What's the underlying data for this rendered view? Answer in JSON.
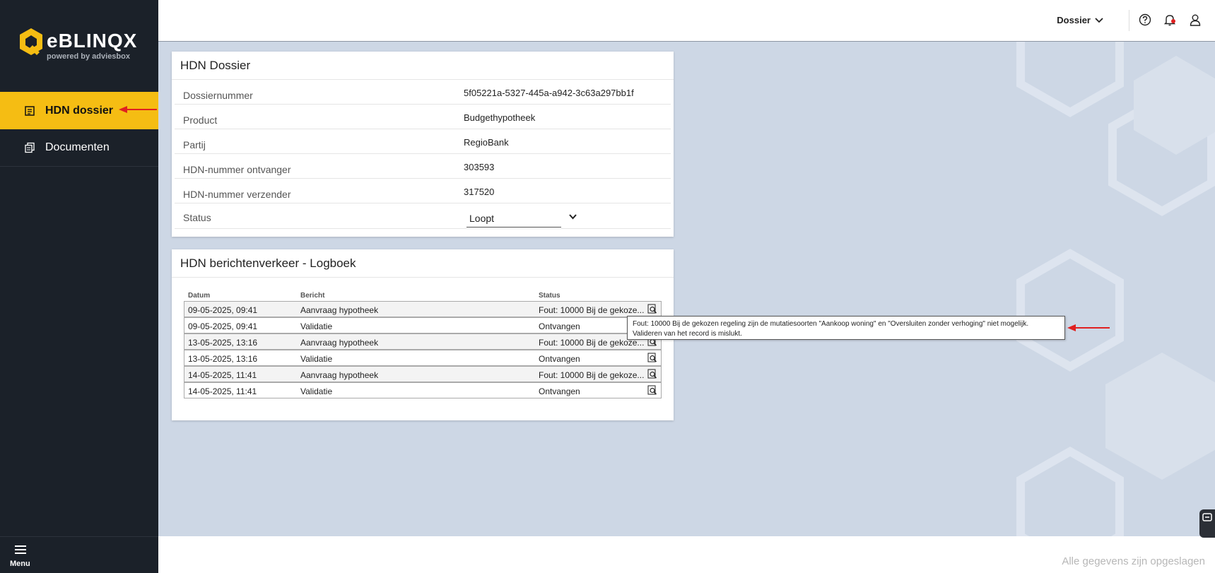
{
  "brand": {
    "name": "BLINQX",
    "e": "e",
    "tagline": "powered by adviesbox",
    "hex_color": "#f5bd13"
  },
  "sidebar": {
    "items": [
      {
        "label": "HDN dossier",
        "icon": "document-list-icon",
        "active": true
      },
      {
        "label": "Documenten",
        "icon": "documents-copy-icon",
        "active": false
      }
    ],
    "menu_label": "Menu"
  },
  "topbar": {
    "dossier_label": "Dossier",
    "icons": [
      "help-icon",
      "notification-bell-icon",
      "user-icon"
    ]
  },
  "hdn_dossier": {
    "title": "HDN Dossier",
    "fields": [
      {
        "label": "Dossiernummer",
        "value": "5f05221a-5327-445a-a942-3c63a297bb1f"
      },
      {
        "label": "Product",
        "value": "Budgethypotheek"
      },
      {
        "label": "Partij",
        "value": "RegioBank"
      },
      {
        "label": "HDN-nummer ontvanger",
        "value": "303593"
      },
      {
        "label": "HDN-nummer verzender",
        "value": "317520"
      }
    ],
    "status_label": "Status",
    "status_value": "Loopt"
  },
  "log": {
    "title": "HDN berichtenverkeer - Logboek",
    "headers": {
      "datum": "Datum",
      "bericht": "Bericht",
      "status": "Status"
    },
    "rows": [
      {
        "datum": "09-05-2025, 09:41",
        "bericht": "Aanvraag hypotheek",
        "status": "Fout: 10000 Bij de gekoze..."
      },
      {
        "datum": "09-05-2025, 09:41",
        "bericht": "Validatie",
        "status": "Ontvangen"
      },
      {
        "datum": "13-05-2025, 13:16",
        "bericht": "Aanvraag hypotheek",
        "status": "Fout: 10000 Bij de gekoze..."
      },
      {
        "datum": "13-05-2025, 13:16",
        "bericht": "Validatie",
        "status": "Ontvangen"
      },
      {
        "datum": "14-05-2025, 11:41",
        "bericht": "Aanvraag hypotheek",
        "status": "Fout: 10000 Bij de gekoze..."
      },
      {
        "datum": "14-05-2025, 11:41",
        "bericht": "Validatie",
        "status": "Ontvangen"
      }
    ]
  },
  "tooltip": {
    "line1": "Fout: 10000 Bij de gekozen regeling zijn de mutatiesoorten \"Aankoop woning\" en \"Oversluiten zonder verhoging\" niet mogelijk.",
    "line2": "Valideren van het record is mislukt."
  },
  "footer": {
    "saved_text": "Alle gegevens zijn opgeslagen"
  },
  "colors": {
    "accent": "#f5bd13",
    "sidebar": "#1b2129",
    "background": "#cdd7e5",
    "annotation_arrow": "#e02020"
  }
}
